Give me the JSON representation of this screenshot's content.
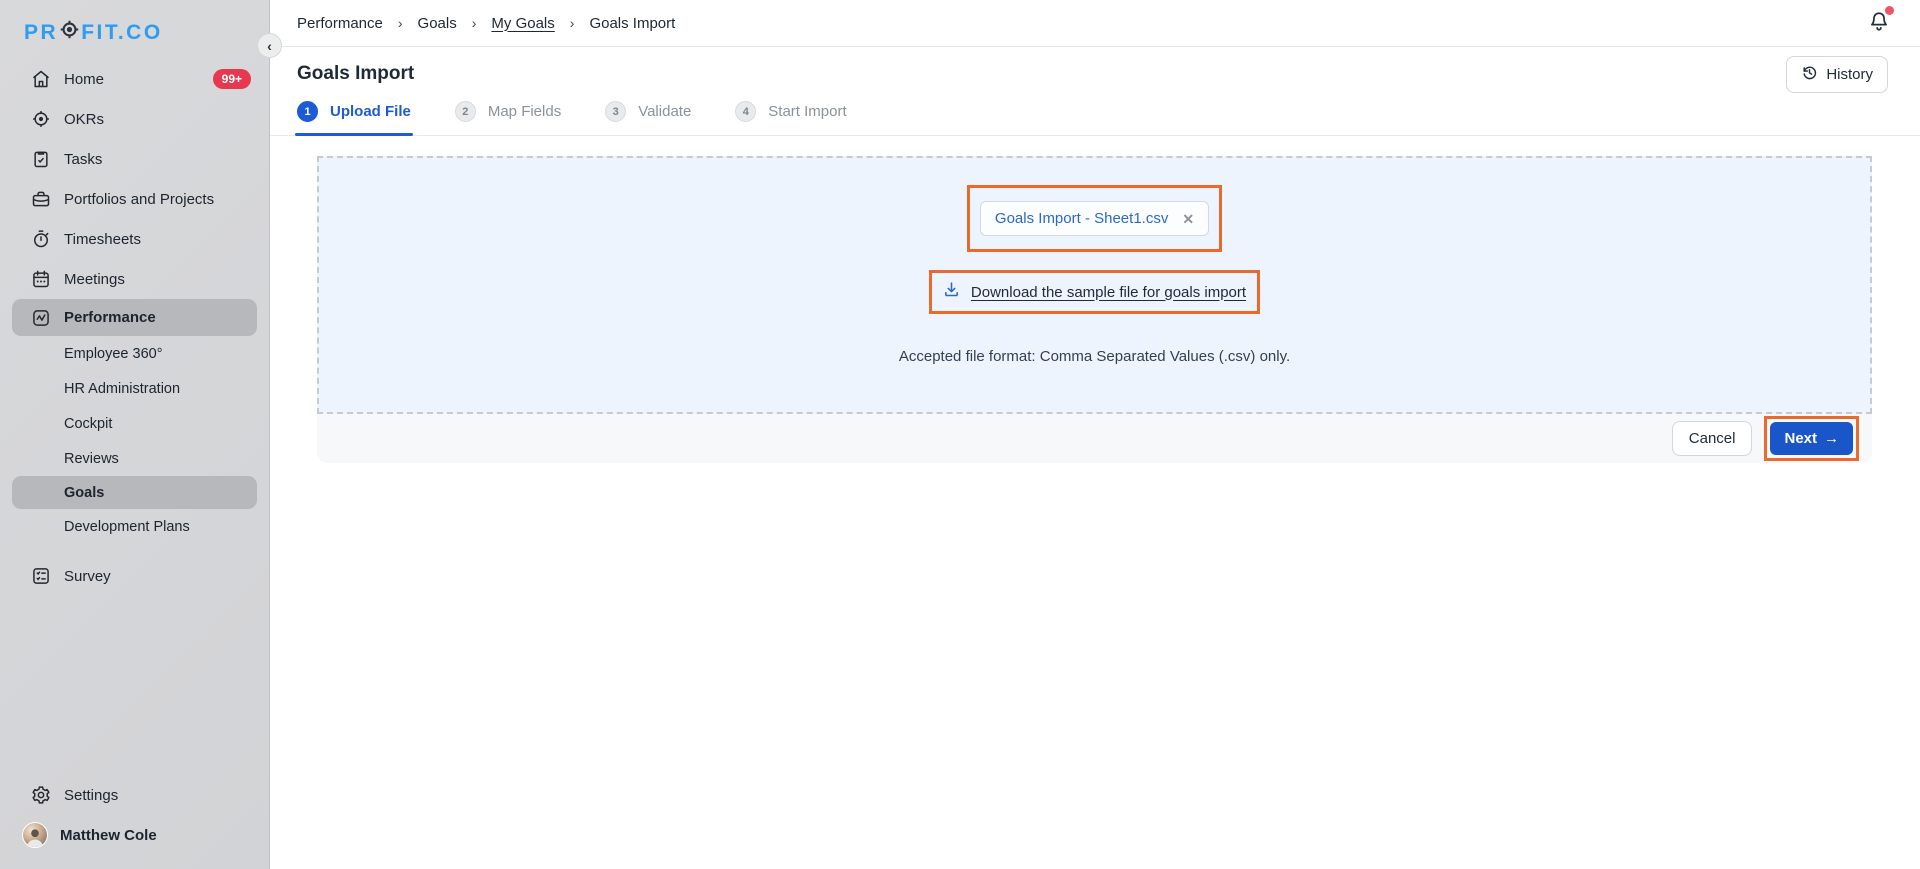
{
  "brand": {
    "pre": "PR",
    "post": "FIT.CO"
  },
  "sidebar": {
    "collapse_glyph": "‹",
    "items": [
      {
        "label": "Home",
        "badge": "99+"
      },
      {
        "label": "OKRs"
      },
      {
        "label": "Tasks"
      },
      {
        "label": "Portfolios and Projects"
      },
      {
        "label": "Timesheets"
      },
      {
        "label": "Meetings"
      },
      {
        "label": "Performance"
      },
      {
        "label": "Survey"
      }
    ],
    "performance_children": [
      {
        "label": "Employee 360°"
      },
      {
        "label": "HR Administration"
      },
      {
        "label": "Cockpit"
      },
      {
        "label": "Reviews"
      },
      {
        "label": "Goals"
      },
      {
        "label": "Development Plans"
      }
    ],
    "settings_label": "Settings",
    "user_name": "Matthew Cole"
  },
  "topbar": {
    "breadcrumb": [
      "Performance",
      "Goals",
      "My Goals",
      "Goals Import"
    ],
    "separator": "›"
  },
  "page": {
    "title": "Goals Import",
    "history_label": "History"
  },
  "steps": [
    {
      "num": "1",
      "label": "Upload File"
    },
    {
      "num": "2",
      "label": "Map Fields"
    },
    {
      "num": "3",
      "label": "Validate"
    },
    {
      "num": "4",
      "label": "Start Import"
    }
  ],
  "upload": {
    "file_chip": "Goals Import - Sheet1.csv",
    "remove_glyph": "✕",
    "download_link": "Download the sample file for goals import",
    "accepted_note": "Accepted file format: Comma Separated Values (.csv) only."
  },
  "actions": {
    "cancel": "Cancel",
    "next": "Next",
    "next_arrow": "→"
  },
  "colors": {
    "accent_blue": "#1d5bd6",
    "logo_blue": "#2f9bf1",
    "annotation_orange": "#ea6a2d",
    "badge_red": "#e8384f"
  }
}
